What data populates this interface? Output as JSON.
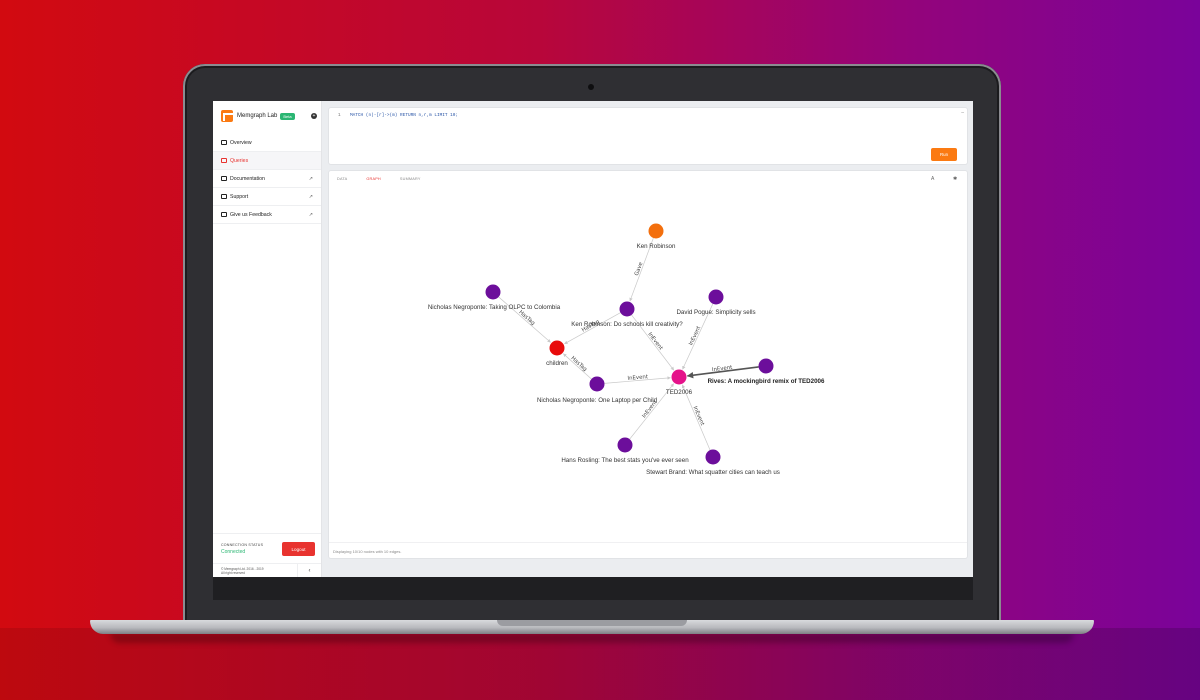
{
  "app": {
    "name": "Memgraph Lab",
    "badge": "Beta"
  },
  "sidebar": {
    "items": [
      {
        "label": "Overview",
        "icon": "overview-icon",
        "active": false
      },
      {
        "label": "Queries",
        "icon": "queries-icon",
        "active": true
      },
      {
        "label": "Documentation",
        "icon": "documentation-icon",
        "active": false,
        "external": true
      },
      {
        "label": "Support",
        "icon": "support-icon",
        "active": false,
        "external": true
      },
      {
        "label": "Give us Feedback",
        "icon": "feedback-icon",
        "active": false,
        "external": true
      }
    ],
    "connection_label": "CONNECTION STATUS",
    "connection_status": "Connected",
    "logout_label": "Logout",
    "copyright": "© Memgraph Ltd. 2016 - 2019",
    "rights": "All right reserved",
    "collapse_icon": "‹"
  },
  "editor": {
    "line_number": "1",
    "query": "MATCH (n)-[r]->(m) RETURN n,r,m LIMIT 10;",
    "run_label": "Run"
  },
  "result": {
    "tabs": [
      {
        "label": "DATA",
        "active": false
      },
      {
        "label": "GRAPH",
        "active": true
      },
      {
        "label": "SUMMARY",
        "active": false
      }
    ],
    "status": "Displaying 10/10 nodes with 10 edges."
  },
  "graph": {
    "colors": {
      "person": "#f36f0d",
      "talk": "#6c0e9b",
      "tag": "#e80b0b",
      "event": "#e5128a"
    },
    "nodes": [
      {
        "id": "ken",
        "label": "Ken Robinson",
        "type": "person"
      },
      {
        "id": "talk_ken",
        "label": "Ken Robinson: Do schools kill creativity?",
        "type": "talk"
      },
      {
        "id": "talk_olpc_col",
        "label": "Nicholas Negroponte: Taking OLPC to Colombia",
        "type": "talk"
      },
      {
        "id": "children",
        "label": "children",
        "type": "tag"
      },
      {
        "id": "talk_olpc",
        "label": "Nicholas Negroponte: One Laptop per Child",
        "type": "talk"
      },
      {
        "id": "ted2006",
        "label": "TED2006",
        "type": "event"
      },
      {
        "id": "talk_pogue",
        "label": "David Pogue: Simplicity sells",
        "type": "talk"
      },
      {
        "id": "talk_rives",
        "label": "Rives: A mockingbird remix of TED2006",
        "type": "talk",
        "bold": true
      },
      {
        "id": "talk_rosling",
        "label": "Hans Rosling: The best stats you've ever seen",
        "type": "talk"
      },
      {
        "id": "talk_brand",
        "label": "Stewart Brand: What squatter cities can teach us",
        "type": "talk"
      }
    ],
    "edges": [
      {
        "from": "ken",
        "to": "talk_ken",
        "label": "Gave"
      },
      {
        "from": "talk_ken",
        "to": "children",
        "label": "HasTag"
      },
      {
        "from": "talk_olpc_col",
        "to": "children",
        "label": "HasTag"
      },
      {
        "from": "talk_olpc",
        "to": "children",
        "label": "HasTag"
      },
      {
        "from": "talk_ken",
        "to": "ted2006",
        "label": "InEvent"
      },
      {
        "from": "talk_pogue",
        "to": "ted2006",
        "label": "InEvent"
      },
      {
        "from": "talk_rives",
        "to": "ted2006",
        "label": "InEvent",
        "highlighted": true
      },
      {
        "from": "talk_olpc",
        "to": "ted2006",
        "label": "InEvent"
      },
      {
        "from": "talk_rosling",
        "to": "ted2006",
        "label": "InEvent"
      },
      {
        "from": "talk_brand",
        "to": "ted2006",
        "label": "InEvent"
      }
    ]
  }
}
